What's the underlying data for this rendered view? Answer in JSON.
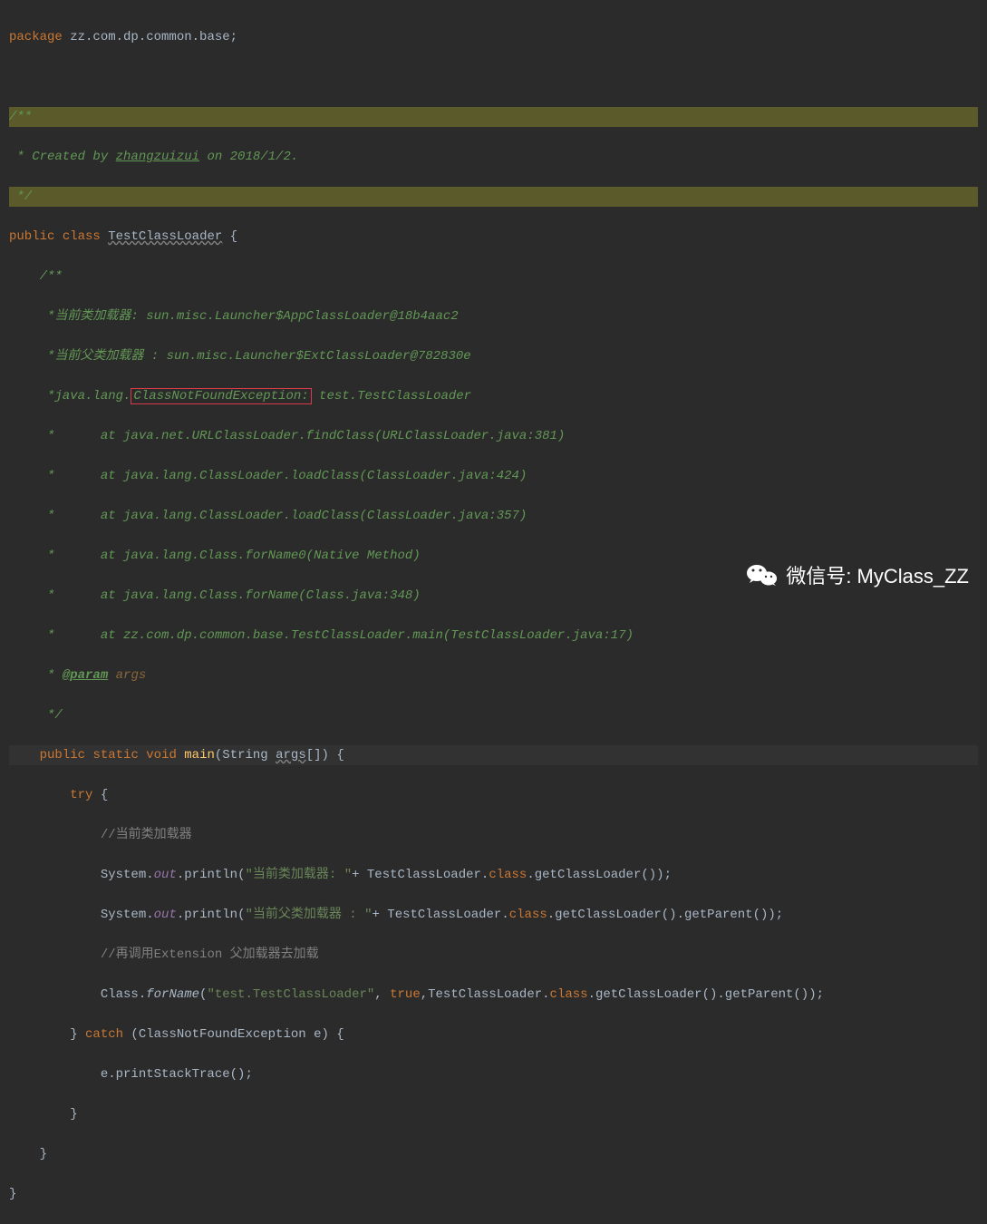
{
  "code": {
    "package_kw": "package",
    "package_name": " zz.com.dp.common.base;",
    "doc1_open": "/**",
    "doc1_line1": " * Created by ",
    "doc1_author": "zhangzuizui",
    "doc1_date": " on 2018/1/2.",
    "doc1_close": " */",
    "public_kw": "public",
    "class_kw": "class",
    "class_name": "TestClassLoader",
    "brace_open": " {",
    "doc2_open": "    /**",
    "doc2_l1": "     *当前类加载器: sun.misc.Launcher$AppClassLoader@18b4aac2",
    "doc2_l2": "     *当前父类加载器 : sun.misc.Launcher$ExtClassLoader@782830e",
    "doc2_l3a": "     *java.lang.",
    "doc2_l3box": "ClassNotFoundException:",
    "doc2_l3b": " test.TestClassLoader",
    "doc2_l4": "     *      at java.net.URLClassLoader.findClass(URLClassLoader.java:381)",
    "doc2_l5": "     *      at java.lang.ClassLoader.loadClass(ClassLoader.java:424)",
    "doc2_l6": "     *      at java.lang.ClassLoader.loadClass(ClassLoader.java:357)",
    "doc2_l7": "     *      at java.lang.Class.forName0(Native Method)",
    "doc2_l8": "     *      at java.lang.Class.forName(Class.java:348)",
    "doc2_l9": "     *      at zz.com.dp.common.base.TestClassLoader.main(TestClassLoader.java:17)",
    "doc2_param_star": "     * ",
    "doc2_param_tag": "@param",
    "doc2_param_name": " args",
    "doc2_close": "     */",
    "main_indent": "    ",
    "static_kw": "static",
    "void_kw": "void",
    "main_name": "main",
    "main_params_open": "(String ",
    "main_args": "args",
    "main_params_close": "[]) {",
    "try_indent": "        ",
    "try_kw": "try",
    "try_brace": " {",
    "comment1_indent": "            ",
    "comment1": "//当前类加载器",
    "print1_indent": "            System.",
    "out_field": "out",
    "println": ".println(",
    "str1": "\"当前类加载器: \"",
    "print1_end": "+ TestClassLoader.",
    "class_field": "class",
    "print1_end2": ".getClassLoader());",
    "str2": "\"当前父类加载器 : \"",
    "print2_end": "+ TestClassLoader.",
    "print2_end2": ".getClassLoader().getParent());",
    "comment2": "//再调用Extension 父加载器去加载",
    "forname_indent": "            Class.",
    "forname": "forName",
    "forname_open": "(",
    "str3": "\"test.TestClassLoader\"",
    "forname_mid": ", ",
    "true_kw": "true",
    "forname_mid2": ",TestClassLoader.",
    "forname_end": ".getClassLoader().getParent());",
    "catch_indent": "        } ",
    "catch_kw": "catch",
    "catch_params": " (ClassNotFoundException e) {",
    "stacktrace": "            e.printStackTrace();",
    "catch_close": "        }",
    "main_close": "    }",
    "class_close": "}"
  },
  "watermark": {
    "label": "微信号: MyClass_ZZ"
  }
}
